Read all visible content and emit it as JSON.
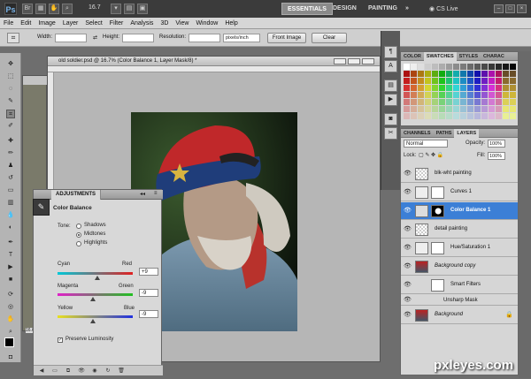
{
  "app": {
    "logo": "Ps",
    "mini_label": "Br",
    "zoom_select": "16.7",
    "workspaces": [
      "ESSENTIALS",
      "DESIGN",
      "PAINTING",
      "»"
    ],
    "cs_live": "CS Live"
  },
  "menu": [
    "File",
    "Edit",
    "Image",
    "Layer",
    "Select",
    "Filter",
    "Analysis",
    "3D",
    "View",
    "Window",
    "Help"
  ],
  "options_bar": {
    "width_label": "Width:",
    "height_label": "Height:",
    "resolution_label": "Resolution:",
    "resolution_unit": "pixels/inch",
    "front_image": "Front Image",
    "clear": "Clear"
  },
  "document": {
    "title": "old soldier.psd @ 16.7% (Color Balance 1, Layer Mask/8) *",
    "zoom": "16.67%"
  },
  "adjustments": {
    "tab": "ADJUSTMENTS",
    "title": "Color Balance",
    "tone_label": "Tone:",
    "tones": [
      "Shadows",
      "Midtones",
      "Highlights"
    ],
    "selected_tone": "Midtones",
    "sliders": [
      {
        "left": "Cyan",
        "right": "Red",
        "value": "+9",
        "position": 0.53
      },
      {
        "left": "Magenta",
        "right": "Green",
        "value": "-9",
        "position": 0.47
      },
      {
        "left": "Yellow",
        "right": "Blue",
        "value": "-9",
        "position": 0.47
      }
    ],
    "preserve_luminosity": "Preserve Luminosity"
  },
  "swatches_panel": {
    "tabs": [
      "COLOR",
      "SWATCHES",
      "STYLES",
      "CHARAC"
    ],
    "active_tab": "SWATCHES"
  },
  "layers_panel": {
    "tabs": [
      "CHANNELS",
      "PATHS",
      "LAYERS"
    ],
    "blend_mode": "Normal",
    "opacity_label": "Opacity:",
    "opacity": "100%",
    "lock_label": "Lock:",
    "fill_label": "Fill:",
    "fill": "100%",
    "layers": [
      {
        "name": "blk-wht painting",
        "selected": false
      },
      {
        "name": "Curves 1",
        "selected": false
      },
      {
        "name": "Color Balance 1",
        "selected": true
      },
      {
        "name": "detail painting",
        "selected": false
      },
      {
        "name": "Hue/Saturation 1",
        "selected": false
      },
      {
        "name": "Background copy",
        "selected": false
      },
      {
        "name": "Smart Filters",
        "selected": false
      },
      {
        "name": "Unsharp Mask",
        "selected": false
      },
      {
        "name": "Background",
        "selected": false
      }
    ]
  },
  "watermark": "pxleyes.com"
}
